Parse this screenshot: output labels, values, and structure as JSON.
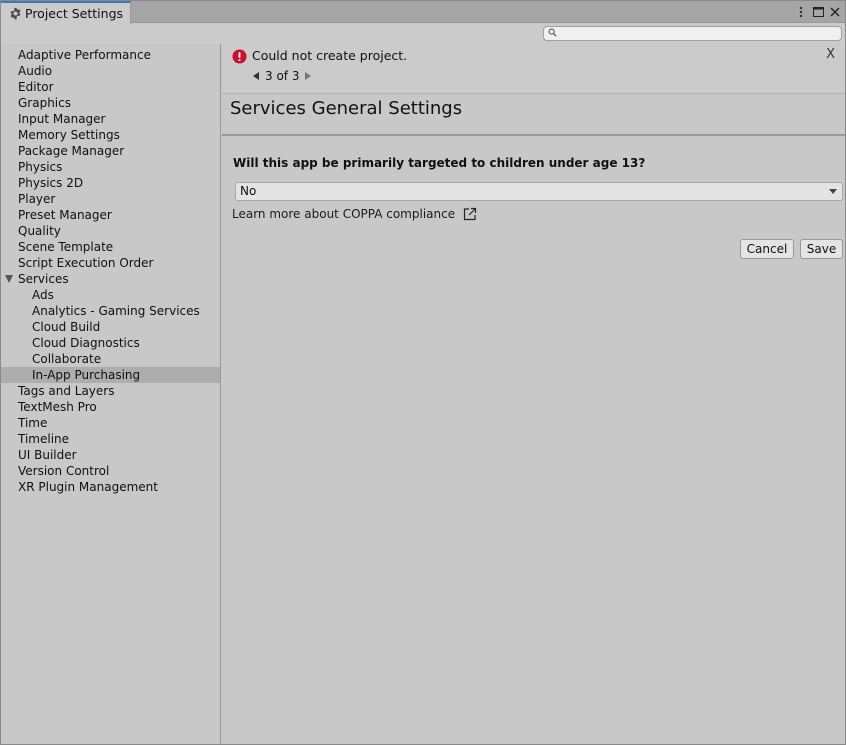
{
  "window": {
    "title": "Project Settings",
    "more_icon": "more-vert-icon",
    "maximize_icon": "maximize-icon",
    "close_icon": "close-icon"
  },
  "search": {
    "value": "",
    "placeholder": ""
  },
  "sidebar": {
    "items": [
      {
        "label": "Adaptive Performance",
        "level": 0
      },
      {
        "label": "Audio",
        "level": 0
      },
      {
        "label": "Editor",
        "level": 0
      },
      {
        "label": "Graphics",
        "level": 0
      },
      {
        "label": "Input Manager",
        "level": 0
      },
      {
        "label": "Memory Settings",
        "level": 0
      },
      {
        "label": "Package Manager",
        "level": 0
      },
      {
        "label": "Physics",
        "level": 0
      },
      {
        "label": "Physics 2D",
        "level": 0
      },
      {
        "label": "Player",
        "level": 0
      },
      {
        "label": "Preset Manager",
        "level": 0
      },
      {
        "label": "Quality",
        "level": 0
      },
      {
        "label": "Scene Template",
        "level": 0
      },
      {
        "label": "Script Execution Order",
        "level": 0
      },
      {
        "label": "Services",
        "level": 0,
        "expanded": true
      },
      {
        "label": "Ads",
        "level": 1
      },
      {
        "label": "Analytics - Gaming Services",
        "level": 1
      },
      {
        "label": "Cloud Build",
        "level": 1
      },
      {
        "label": "Cloud Diagnostics",
        "level": 1
      },
      {
        "label": "Collaborate",
        "level": 1
      },
      {
        "label": "In-App Purchasing",
        "level": 1,
        "selected": true
      },
      {
        "label": "Tags and Layers",
        "level": 0
      },
      {
        "label": "TextMesh Pro",
        "level": 0
      },
      {
        "label": "Time",
        "level": 0
      },
      {
        "label": "Timeline",
        "level": 0
      },
      {
        "label": "UI Builder",
        "level": 0
      },
      {
        "label": "Version Control",
        "level": 0
      },
      {
        "label": "XR Plugin Management",
        "level": 0
      }
    ]
  },
  "notice": {
    "message": "Could not create project.",
    "close_label": "X",
    "pager": "3 of 3",
    "icon": "error-icon",
    "icon_color": "#c8102e"
  },
  "main": {
    "header": "Services General Settings",
    "question": "Will this app be primarily targeted to children under age 13?",
    "dropdown_value": "No",
    "learn_more": "Learn more about COPPA compliance",
    "cancel_label": "Cancel",
    "save_label": "Save"
  },
  "colors": {
    "background": "#c8c8c8",
    "selected_row": "#adadad",
    "tab_accent": "#3a79bb"
  }
}
